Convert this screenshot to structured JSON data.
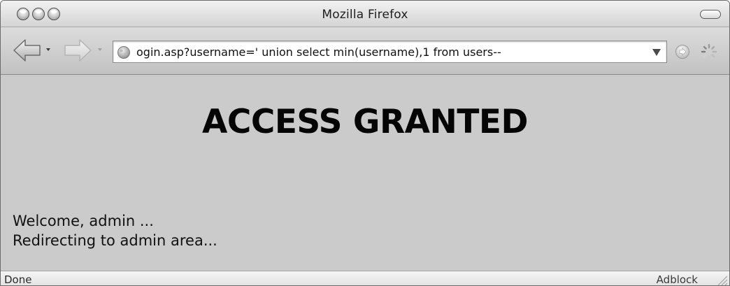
{
  "window": {
    "title": "Mozilla Firefox"
  },
  "toolbar": {
    "url": "ogin.asp?username=' union select min(username),1 from users--",
    "back_icon": "back-arrow-icon",
    "forward_icon": "forward-arrow-icon",
    "go_icon": "go-icon",
    "throbber_icon": "loading-throbber-icon"
  },
  "page": {
    "heading": "ACCESS GRANTED",
    "lines": [
      "Welcome, admin ...",
      "Redirecting to admin area..."
    ],
    "background_color": "#cbcbcb"
  },
  "statusbar": {
    "status": "Done",
    "extension": "Adblock"
  }
}
